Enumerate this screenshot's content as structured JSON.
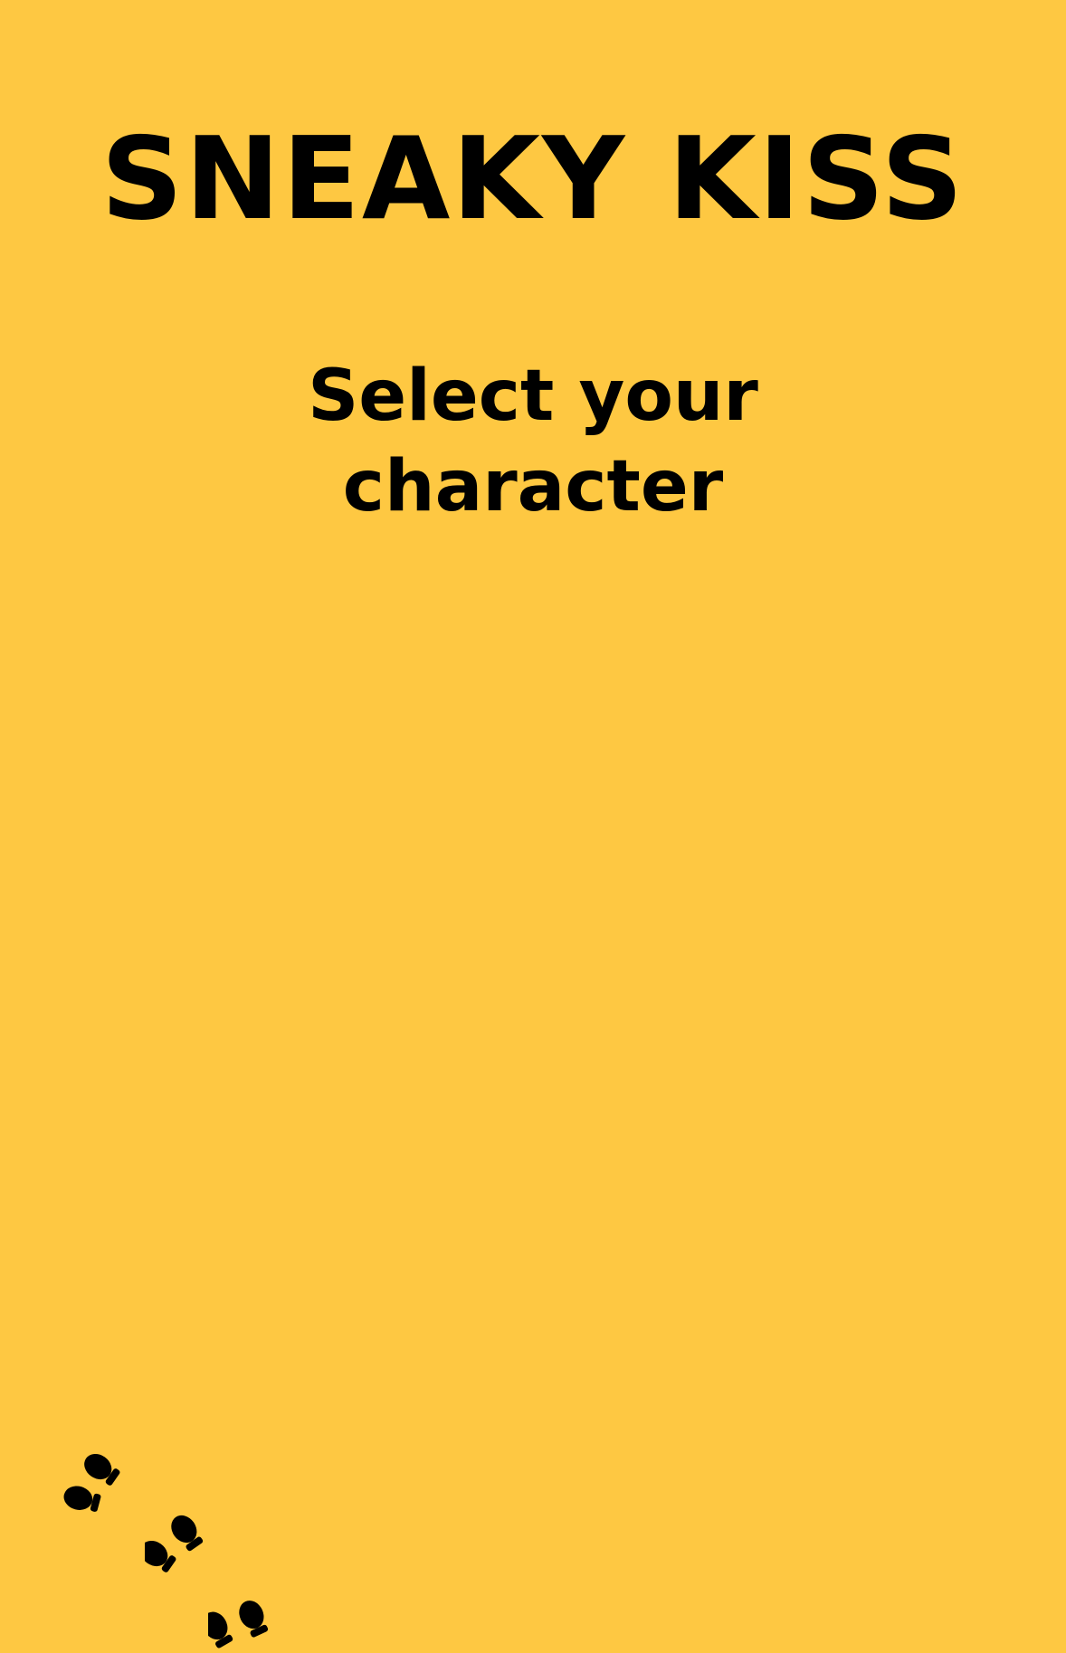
{
  "game": {
    "title": "SNEAKY KISS",
    "subtitle": "Select your character"
  },
  "colors": {
    "background": "#FEC842",
    "text": "#000000",
    "footprints": "#000000"
  },
  "icons": {
    "footprints": "footprints-icon"
  }
}
